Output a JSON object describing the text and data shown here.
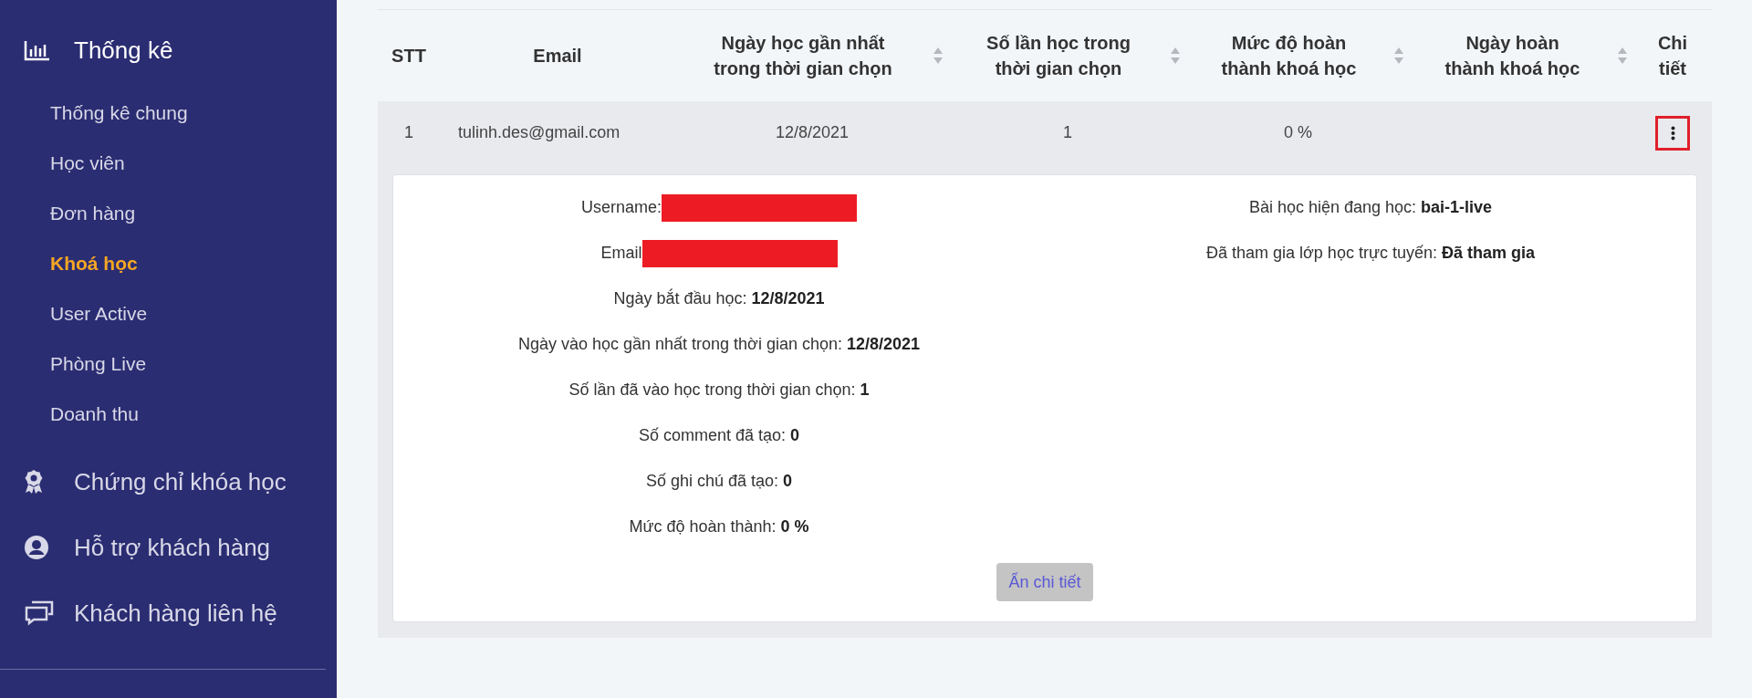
{
  "sidebar": {
    "items": [
      {
        "label": "Thống kê",
        "expanded": true,
        "children": [
          {
            "label": "Thống kê chung",
            "selected": false
          },
          {
            "label": "Học viên",
            "selected": false
          },
          {
            "label": "Đơn hàng",
            "selected": false
          },
          {
            "label": "Khoá học",
            "selected": true
          },
          {
            "label": "User Active",
            "selected": false
          },
          {
            "label": "Phòng Live",
            "selected": false
          },
          {
            "label": "Doanh thu",
            "selected": false
          }
        ]
      },
      {
        "label": "Chứng chỉ khóa học"
      },
      {
        "label": "Hỗ trợ khách hàng"
      },
      {
        "label": "Khách hàng liên hệ"
      }
    ]
  },
  "table": {
    "columns": [
      {
        "label": "STT",
        "sortable": false
      },
      {
        "label": "Email",
        "sortable": false
      },
      {
        "label": "Ngày học gần nhất trong thời gian chọn",
        "sortable": true
      },
      {
        "label": "Số lần học trong thời gian chọn",
        "sortable": true
      },
      {
        "label": "Mức độ hoàn thành khoá học",
        "sortable": true
      },
      {
        "label": "Ngày hoàn thành khoá học",
        "sortable": true
      },
      {
        "label": "Chi tiết",
        "sortable": false
      }
    ],
    "rows": [
      {
        "cells": [
          "1",
          "tulinh.des@gmail.com",
          "12/8/2021",
          "1",
          "0 %",
          ""
        ],
        "expanded": true,
        "details": {
          "left": [
            {
              "label": "Username:",
              "redacted": true
            },
            {
              "label": "Email",
              "redacted": true
            },
            {
              "label": "Ngày bắt đầu học:",
              "value": "12/8/2021"
            },
            {
              "label": "Ngày vào học gần nhất trong thời gian chọn:",
              "value": "12/8/2021"
            },
            {
              "label": "Số lần đã vào học trong thời gian chọn:",
              "value": "1"
            },
            {
              "label": "Số comment đã tạo:",
              "value": "0"
            },
            {
              "label": "Số ghi chú đã tạo:",
              "value": "0"
            },
            {
              "label": "Mức độ hoàn thành:",
              "value": "0 %"
            }
          ],
          "right": [
            {
              "label": "Bài học hiện đang học:",
              "value": "bai-1-live"
            },
            {
              "label": "Đã tham gia lớp học trực tuyến:",
              "value": "Đã tham gia"
            }
          ],
          "button": "Ẩn chi tiết"
        }
      }
    ]
  }
}
